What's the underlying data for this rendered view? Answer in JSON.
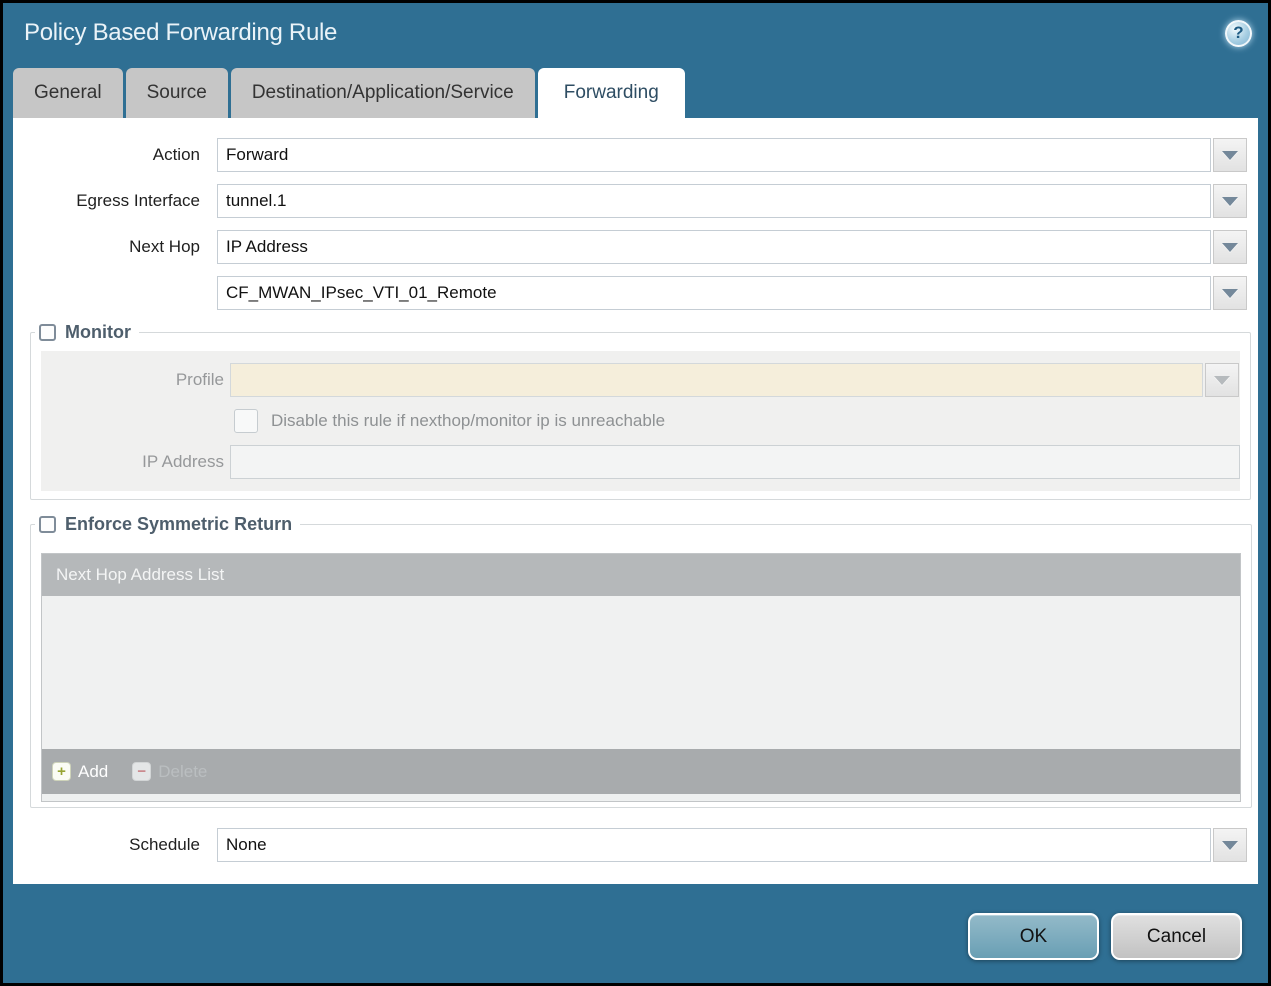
{
  "dialog": {
    "title": "Policy Based Forwarding Rule"
  },
  "icons": {
    "help": "?",
    "add": "+",
    "delete": "−"
  },
  "tabs": [
    {
      "label": "General",
      "active": false
    },
    {
      "label": "Source",
      "active": false
    },
    {
      "label": "Destination/Application/Service",
      "active": false
    },
    {
      "label": "Forwarding",
      "active": true
    }
  ],
  "form": {
    "action": {
      "label": "Action",
      "value": "Forward"
    },
    "egress_interface": {
      "label": "Egress Interface",
      "value": "tunnel.1"
    },
    "next_hop": {
      "label": "Next Hop",
      "value": "IP Address"
    },
    "next_hop_address": {
      "label": "",
      "value": "CF_MWAN_IPsec_VTI_01_Remote"
    },
    "schedule": {
      "label": "Schedule",
      "value": "None"
    }
  },
  "monitor": {
    "legend": "Monitor",
    "checked": false,
    "profile": {
      "label": "Profile",
      "value": "",
      "disabled": true
    },
    "disable_rule_checkbox": {
      "label": "Disable this rule if nexthop/monitor ip is unreachable",
      "checked": false,
      "disabled": true
    },
    "ip_address": {
      "label": "IP Address",
      "value": "",
      "disabled": true
    }
  },
  "symmetric_return": {
    "legend": "Enforce Symmetric Return",
    "checked": false,
    "table": {
      "header": "Next Hop Address List",
      "rows": []
    },
    "add_label": "Add",
    "delete_label": "Delete",
    "delete_disabled": true
  },
  "buttons": {
    "ok": "OK",
    "cancel": "Cancel"
  },
  "colors": {
    "accent_teal": "#2f6f93",
    "disabled_field_beige": "#f5eedb",
    "table_header_gray": "#b5b8ba",
    "ok_button_teal": "#699fb4"
  }
}
